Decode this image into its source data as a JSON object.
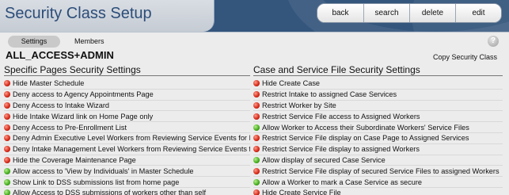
{
  "header": {
    "title": "Security Class Setup"
  },
  "actions": [
    "back",
    "search",
    "delete",
    "edit"
  ],
  "tabs": [
    {
      "label": "Settings",
      "active": true
    },
    {
      "label": "Members",
      "active": false
    }
  ],
  "class_name": "ALL_ACCESS+ADMIN",
  "copy_link": "Copy Security Class",
  "colors": {
    "header_bg": "#34557c",
    "title_color": "#2c4d79",
    "enabled": "#3aa512",
    "disabled": "#d11d0c"
  },
  "left": {
    "heading": "Specific Pages Security Settings",
    "items": [
      {
        "label": "Hide Master Schedule",
        "status": "red"
      },
      {
        "label": "Deny access to Agency Appointments Page",
        "status": "red"
      },
      {
        "label": "Deny Access to Intake Wizard",
        "status": "red"
      },
      {
        "label": "Hide Intake Wizard link on Home Page only",
        "status": "red"
      },
      {
        "label": "Deny Access to Pre-Enrollment List",
        "status": "red"
      },
      {
        "label": "Deny Admin Executive Level Workers from Reviewing Service Events for Invoicing",
        "status": "red"
      },
      {
        "label": "Deny Intake Management Level Workers from Reviewing Service Events for Invoicing",
        "status": "red"
      },
      {
        "label": "Hide the Coverage Maintenance Page",
        "status": "red"
      },
      {
        "label": "Allow access to 'View by Individuals' in Master Schedule",
        "status": "green"
      },
      {
        "label": "Show Link to DSS submissions list from home page",
        "status": "green"
      },
      {
        "label": "Allow Access to DSS submissions of workers other than self",
        "status": "green"
      }
    ]
  },
  "right": {
    "heading": "Case and Service File Security Settings",
    "items": [
      {
        "label": "Hide Create Case",
        "status": "red"
      },
      {
        "label": "Restrict Intake to assigned Case Services",
        "status": "red"
      },
      {
        "label": "Restrict Worker by Site",
        "status": "red"
      },
      {
        "label": "Restrict Service File access to Assigned Workers",
        "status": "red"
      },
      {
        "label": "Allow Worker to Access their Subordinate Workers' Service Files",
        "status": "green"
      },
      {
        "label": "Restrict Service File display on Case Page to Assigned Services",
        "status": "red"
      },
      {
        "label": "Restrict Service File display to assigned Workers",
        "status": "red"
      },
      {
        "label": "Allow display of secured Case Service",
        "status": "green"
      },
      {
        "label": "Restrict Service File display of secured Service Files to assigned Workers",
        "status": "red"
      },
      {
        "label": "Allow a Worker to mark a Case Service as secure",
        "status": "green"
      },
      {
        "label": "Hide Create Service File",
        "status": "red"
      }
    ]
  }
}
